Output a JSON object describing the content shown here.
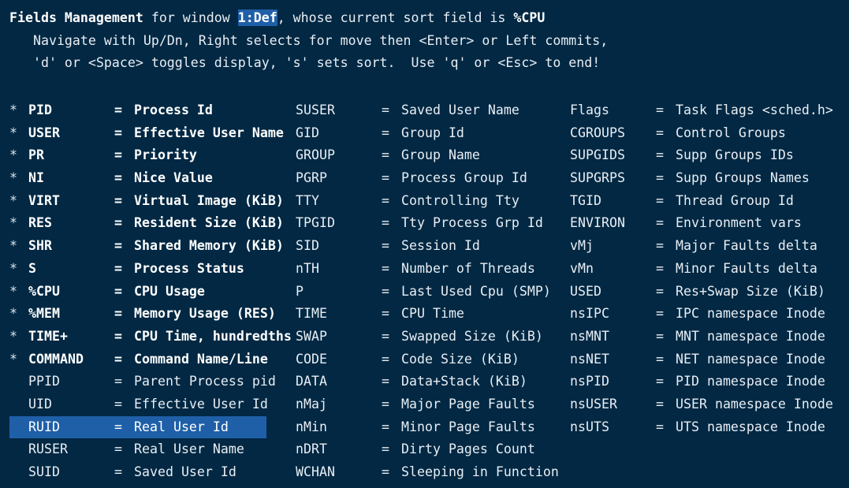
{
  "screen": {
    "background_color": "#022843",
    "text_color": "#e8eef4",
    "highlight_color": "#1f5fa8",
    "highlight_text_color": "#ffffff"
  },
  "header": {
    "line1_part1": "Fields Management",
    "line1_part2": " for window ",
    "line1_window": "1:Def",
    "line1_part3": ", whose current sort field is ",
    "line1_sortfield": "%CPU",
    "line2": "   Navigate with Up/Dn, Right selects for move then <Enter> or Left commits,",
    "line3": "   'd' or <Space> toggles display, 's' sets sort.  Use 'q' or <Esc> to end!"
  },
  "columns": [
    {
      "id": "col-1",
      "rows": [
        {
          "star": "*",
          "name": "PID",
          "eq": "=",
          "desc": "Process Id",
          "on": true,
          "selected": false
        },
        {
          "star": "*",
          "name": "USER",
          "eq": "=",
          "desc": "Effective User Name",
          "on": true,
          "selected": false
        },
        {
          "star": "*",
          "name": "PR",
          "eq": "=",
          "desc": "Priority",
          "on": true,
          "selected": false
        },
        {
          "star": "*",
          "name": "NI",
          "eq": "=",
          "desc": "Nice Value",
          "on": true,
          "selected": false
        },
        {
          "star": "*",
          "name": "VIRT",
          "eq": "=",
          "desc": "Virtual Image (KiB)",
          "on": true,
          "selected": false
        },
        {
          "star": "*",
          "name": "RES",
          "eq": "=",
          "desc": "Resident Size (KiB)",
          "on": true,
          "selected": false
        },
        {
          "star": "*",
          "name": "SHR",
          "eq": "=",
          "desc": "Shared Memory (KiB)",
          "on": true,
          "selected": false
        },
        {
          "star": "*",
          "name": "S",
          "eq": "=",
          "desc": "Process Status",
          "on": true,
          "selected": false
        },
        {
          "star": "*",
          "name": "%CPU",
          "eq": "=",
          "desc": "CPU Usage",
          "on": true,
          "selected": false
        },
        {
          "star": "*",
          "name": "%MEM",
          "eq": "=",
          "desc": "Memory Usage (RES)",
          "on": true,
          "selected": false
        },
        {
          "star": "*",
          "name": "TIME+",
          "eq": "=",
          "desc": "CPU Time, hundredths",
          "on": true,
          "selected": false
        },
        {
          "star": "*",
          "name": "COMMAND",
          "eq": "=",
          "desc": "Command Name/Line",
          "on": true,
          "selected": false
        },
        {
          "star": " ",
          "name": "PPID",
          "eq": "=",
          "desc": "Parent Process pid",
          "on": false,
          "selected": false
        },
        {
          "star": " ",
          "name": "UID",
          "eq": "=",
          "desc": "Effective User Id",
          "on": false,
          "selected": false
        },
        {
          "star": " ",
          "name": "RUID",
          "eq": "=",
          "desc": "Real User Id",
          "on": false,
          "selected": true
        },
        {
          "star": " ",
          "name": "RUSER",
          "eq": "=",
          "desc": "Real User Name",
          "on": false,
          "selected": false
        },
        {
          "star": " ",
          "name": "SUID",
          "eq": "=",
          "desc": "Saved User Id",
          "on": false,
          "selected": false
        }
      ]
    },
    {
      "id": "col-2",
      "rows": [
        {
          "star": "",
          "name": "SUSER",
          "eq": "=",
          "desc": "Saved User Name",
          "on": false,
          "selected": false
        },
        {
          "star": "",
          "name": "GID",
          "eq": "=",
          "desc": "Group Id",
          "on": false,
          "selected": false
        },
        {
          "star": "",
          "name": "GROUP",
          "eq": "=",
          "desc": "Group Name",
          "on": false,
          "selected": false
        },
        {
          "star": "",
          "name": "PGRP",
          "eq": "=",
          "desc": "Process Group Id",
          "on": false,
          "selected": false
        },
        {
          "star": "",
          "name": "TTY",
          "eq": "=",
          "desc": "Controlling Tty",
          "on": false,
          "selected": false
        },
        {
          "star": "",
          "name": "TPGID",
          "eq": "=",
          "desc": "Tty Process Grp Id",
          "on": false,
          "selected": false
        },
        {
          "star": "",
          "name": "SID",
          "eq": "=",
          "desc": "Session Id",
          "on": false,
          "selected": false
        },
        {
          "star": "",
          "name": "nTH",
          "eq": "=",
          "desc": "Number of Threads",
          "on": false,
          "selected": false
        },
        {
          "star": "",
          "name": "P",
          "eq": "=",
          "desc": "Last Used Cpu (SMP)",
          "on": false,
          "selected": false
        },
        {
          "star": "",
          "name": "TIME",
          "eq": "=",
          "desc": "CPU Time",
          "on": false,
          "selected": false
        },
        {
          "star": "",
          "name": "SWAP",
          "eq": "=",
          "desc": "Swapped Size (KiB)",
          "on": false,
          "selected": false
        },
        {
          "star": "",
          "name": "CODE",
          "eq": "=",
          "desc": "Code Size (KiB)",
          "on": false,
          "selected": false
        },
        {
          "star": "",
          "name": "DATA",
          "eq": "=",
          "desc": "Data+Stack (KiB)",
          "on": false,
          "selected": false
        },
        {
          "star": "",
          "name": "nMaj",
          "eq": "=",
          "desc": "Major Page Faults",
          "on": false,
          "selected": false
        },
        {
          "star": "",
          "name": "nMin",
          "eq": "=",
          "desc": "Minor Page Faults",
          "on": false,
          "selected": false
        },
        {
          "star": "",
          "name": "nDRT",
          "eq": "=",
          "desc": "Dirty Pages Count",
          "on": false,
          "selected": false
        },
        {
          "star": "",
          "name": "WCHAN",
          "eq": "=",
          "desc": "Sleeping in Function",
          "on": false,
          "selected": false
        }
      ]
    },
    {
      "id": "col-3",
      "rows": [
        {
          "star": "",
          "name": "Flags",
          "eq": "=",
          "desc": "Task Flags <sched.h>",
          "on": false,
          "selected": false
        },
        {
          "star": "",
          "name": "CGROUPS",
          "eq": "=",
          "desc": "Control Groups",
          "on": false,
          "selected": false
        },
        {
          "star": "",
          "name": "SUPGIDS",
          "eq": "=",
          "desc": "Supp Groups IDs",
          "on": false,
          "selected": false
        },
        {
          "star": "",
          "name": "SUPGRPS",
          "eq": "=",
          "desc": "Supp Groups Names",
          "on": false,
          "selected": false
        },
        {
          "star": "",
          "name": "TGID",
          "eq": "=",
          "desc": "Thread Group Id",
          "on": false,
          "selected": false
        },
        {
          "star": "",
          "name": "ENVIRON",
          "eq": "=",
          "desc": "Environment vars",
          "on": false,
          "selected": false
        },
        {
          "star": "",
          "name": "vMj",
          "eq": "=",
          "desc": "Major Faults delta",
          "on": false,
          "selected": false
        },
        {
          "star": "",
          "name": "vMn",
          "eq": "=",
          "desc": "Minor Faults delta",
          "on": false,
          "selected": false
        },
        {
          "star": "",
          "name": "USED",
          "eq": "=",
          "desc": "Res+Swap Size (KiB)",
          "on": false,
          "selected": false
        },
        {
          "star": "",
          "name": "nsIPC",
          "eq": "=",
          "desc": "IPC namespace Inode",
          "on": false,
          "selected": false
        },
        {
          "star": "",
          "name": "nsMNT",
          "eq": "=",
          "desc": "MNT namespace Inode",
          "on": false,
          "selected": false
        },
        {
          "star": "",
          "name": "nsNET",
          "eq": "=",
          "desc": "NET namespace Inode",
          "on": false,
          "selected": false
        },
        {
          "star": "",
          "name": "nsPID",
          "eq": "=",
          "desc": "PID namespace Inode",
          "on": false,
          "selected": false
        },
        {
          "star": "",
          "name": "nsUSER",
          "eq": "=",
          "desc": "USER namespace Inode",
          "on": false,
          "selected": false
        },
        {
          "star": "",
          "name": "nsUTS",
          "eq": "=",
          "desc": "UTS namespace Inode",
          "on": false,
          "selected": false
        }
      ]
    }
  ]
}
